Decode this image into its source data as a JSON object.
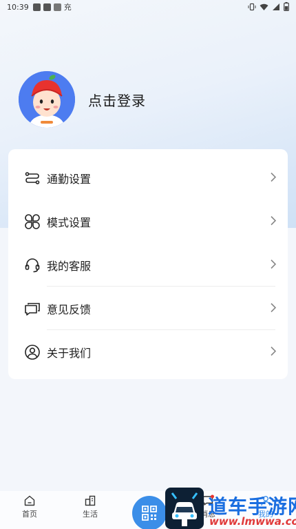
{
  "status_bar": {
    "time": "10:39",
    "glyph": "充"
  },
  "profile": {
    "login_label": "点击登录"
  },
  "menu": {
    "items": [
      {
        "label": "通勤设置",
        "icon": "route-icon"
      },
      {
        "label": "模式设置",
        "icon": "mode-icon"
      },
      {
        "label": "我的客服",
        "icon": "headset-icon"
      },
      {
        "label": "意见反馈",
        "icon": "feedback-icon"
      },
      {
        "label": "关于我们",
        "icon": "about-icon"
      }
    ]
  },
  "tabbar": {
    "tabs": [
      {
        "label": "首页",
        "icon": "home-icon"
      },
      {
        "label": "生活",
        "icon": "life-icon"
      },
      {
        "label": "消息",
        "icon": "message-icon"
      },
      {
        "label": "我的",
        "icon": "profile-icon"
      }
    ]
  },
  "watermark": {
    "title": "道车手游网",
    "url": "www.lmwwa.com"
  },
  "colors": {
    "accent": "#3b8ee8",
    "avatar_bg": "#4d7cf0",
    "text": "#1f1f1f"
  }
}
